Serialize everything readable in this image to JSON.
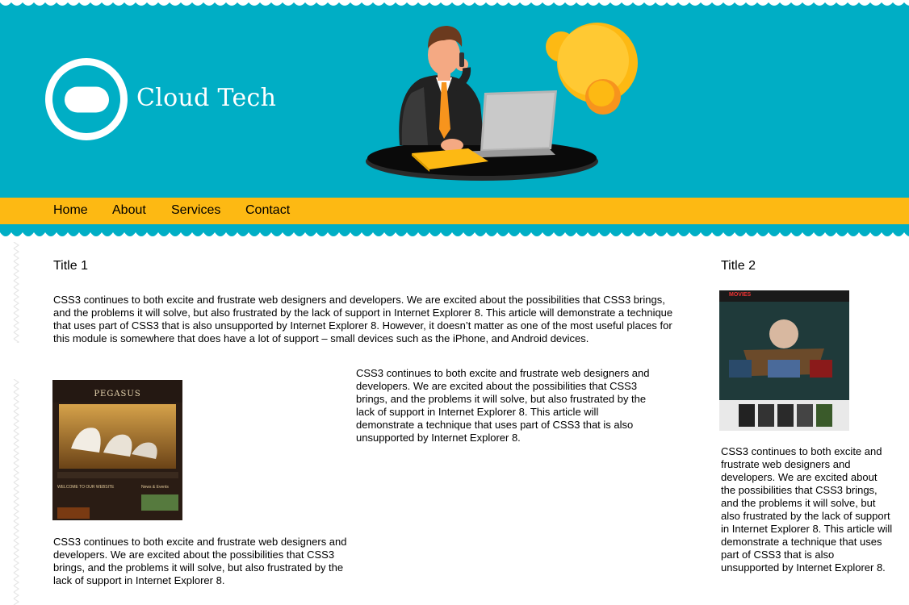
{
  "brand": {
    "name": "Cloud Tech"
  },
  "nav": {
    "items": [
      {
        "label": "Home"
      },
      {
        "label": "About"
      },
      {
        "label": "Services"
      },
      {
        "label": "Contact"
      }
    ]
  },
  "colors": {
    "header": "#00aec5",
    "nav": "#fdb913",
    "accent_orange": "#f7941d"
  },
  "main": {
    "title": "Title 1",
    "intro": "CSS3 continues to both excite and frustrate web designers and developers. We are excited about the possibilities that CSS3 brings, and the problems it will solve, but also frustrated by the lack of support in Internet Explorer 8. This article will demonstrate a technique that uses part of CSS3 that is also unsupported by Internet Explorer 8. However, it doesn’t matter as one of the most useful places for this module is somewhere that does have a lot of support – small devices such as the iPhone, and Android devices.",
    "col_text": "CSS3 continues to both excite and frustrate web designers and developers. We are excited about the possibilities that CSS3 brings, and the problems it will solve, but also frustrated by the lack of support in Internet Explorer 8. This article will demonstrate a technique that uses part of CSS3 that is also unsupported by Internet Explorer 8.",
    "card": {
      "image_title": "PEGASUS",
      "image_caption": "WELCOME TO OUR WEBSITE",
      "image_sidebar": "News & Events",
      "text": "CSS3 continues to both excite and frustrate web designers and developers. We are excited about the possibilities that CSS3 brings, and the problems it will solve, but also frustrated by the lack of support in Internet Explorer 8."
    }
  },
  "sidebar": {
    "title": "Title 2",
    "image_label": "MOVIES",
    "text": "CSS3 continues to both excite and frustrate web designers and developers. We are excited about the possibilities that CSS3 brings, and the problems it will solve, but also frustrated by the lack of support in Internet Explorer 8. This article will demonstrate a technique that uses part of CSS3 that is also unsupported by Internet Explorer 8."
  }
}
